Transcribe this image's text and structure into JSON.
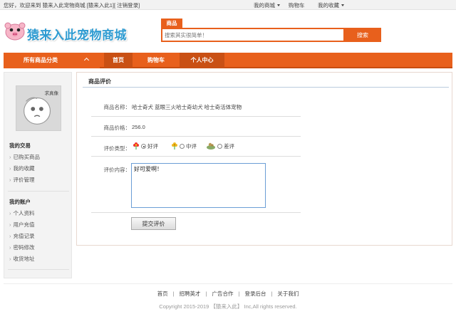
{
  "topbar": {
    "welcome": "您好，欢迎来到 猿来入此宠物商城 [猿来入此1][",
    "logout": "注销登录",
    "welcome_end": "]",
    "links": [
      {
        "label": "我的商城",
        "dropdown": true
      },
      {
        "label": "购物车",
        "dropdown": false
      },
      {
        "label": "我的收藏",
        "dropdown": true
      }
    ]
  },
  "logo": {
    "title": "猿来入此宠物商城"
  },
  "search": {
    "tab": "商品",
    "placeholder": "搜索其实很简单！",
    "button": "搜索"
  },
  "nav": {
    "categories": "所有商品分类",
    "home": "首页",
    "cart": "购物车",
    "user_center": "个人中心"
  },
  "sidebar": {
    "avatar_tag": "求真像",
    "section1": "我的交易",
    "section1_items": [
      "已购买商品",
      "我的收藏",
      "评价管理"
    ],
    "section2": "我的账户",
    "section2_items": [
      "个人资料",
      "用户充值",
      "充值记录",
      "密码修改",
      "收货地址"
    ]
  },
  "review": {
    "title": "商品评价",
    "name_label": "商品名称：",
    "name_value": "哈士奇犬 蓝眼三火哈士奇幼犬 哈士奇活体宠物",
    "price_label": "商品价格：",
    "price_value": "256.0",
    "type_label": "评价类型：",
    "options": [
      "好评",
      "中评",
      "差评"
    ],
    "selected_option": "好评",
    "content_label": "评价内容：",
    "content_value": "好可爱啊！",
    "submit": "提交评价"
  },
  "footer": {
    "links": [
      "首页",
      "招聘英才",
      "广告合作",
      "登录后台",
      "关于我们"
    ],
    "copyright": "Copyright 2015-2019 【猿来入此】 Inc,All rights reserved."
  },
  "colors": {
    "accent": "#e8601c",
    "accent_dark": "#c95014",
    "logo_blue": "#2e9bd1"
  }
}
